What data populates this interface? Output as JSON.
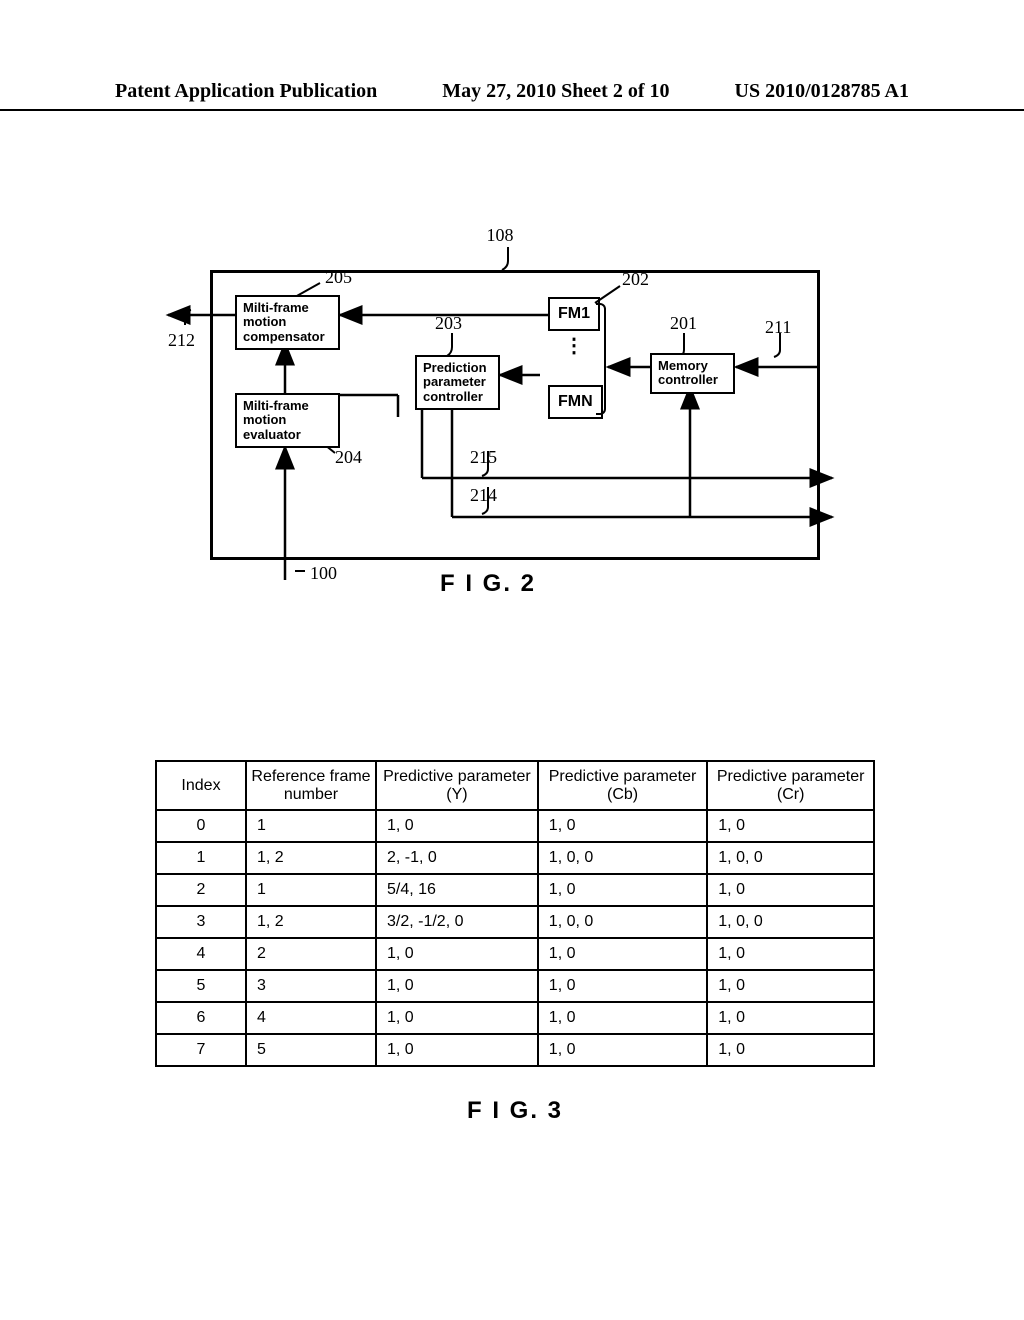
{
  "header": {
    "left": "Patent Application Publication",
    "middle": "May 27, 2010  Sheet 2 of 10",
    "right": "US 2010/0128785 A1"
  },
  "fig2": {
    "top_ref": "108",
    "ref_205": "205",
    "ref_202": "202",
    "ref_212": "212",
    "ref_203": "203",
    "ref_201": "201",
    "ref_211": "211",
    "ref_204": "204",
    "ref_215": "215",
    "ref_214": "214",
    "ref_100": "100",
    "blocks": {
      "compensator": "Milti-frame\nmotion\ncompensator",
      "param_ctrl": "Prediction\nparameter\ncontroller",
      "fm1": "FM1",
      "fmn": "FMN",
      "mem_ctrl": "Memory\ncontroller",
      "evaluator": "Milti-frame\nmotion\nevaluator"
    },
    "label": "F I G. 2"
  },
  "fig3": {
    "headers": {
      "index": "Index",
      "ref": "Reference frame number",
      "y": "Predictive parameter (Y)",
      "cb": "Predictive parameter (Cb)",
      "cr": "Predictive parameter (Cr)"
    },
    "rows": [
      {
        "index": "0",
        "ref": "1",
        "y": "1, 0",
        "cb": "1, 0",
        "cr": "1, 0"
      },
      {
        "index": "1",
        "ref": "1, 2",
        "y": "2, -1, 0",
        "cb": "1, 0, 0",
        "cr": "1, 0, 0"
      },
      {
        "index": "2",
        "ref": "1",
        "y": "5/4, 16",
        "cb": "1, 0",
        "cr": "1, 0"
      },
      {
        "index": "3",
        "ref": "1, 2",
        "y": "3/2, -1/2, 0",
        "cb": "1, 0, 0",
        "cr": "1, 0, 0"
      },
      {
        "index": "4",
        "ref": "2",
        "y": "1, 0",
        "cb": "1, 0",
        "cr": "1, 0"
      },
      {
        "index": "5",
        "ref": "3",
        "y": "1, 0",
        "cb": "1, 0",
        "cr": "1, 0"
      },
      {
        "index": "6",
        "ref": "4",
        "y": "1, 0",
        "cb": "1, 0",
        "cr": "1, 0"
      },
      {
        "index": "7",
        "ref": "5",
        "y": "1, 0",
        "cb": "1, 0",
        "cr": "1, 0"
      }
    ],
    "label": "F I G. 3"
  },
  "chart_data": {
    "type": "table",
    "title": "F I G. 3",
    "columns": [
      "Index",
      "Reference frame number",
      "Predictive parameter (Y)",
      "Predictive parameter (Cb)",
      "Predictive parameter (Cr)"
    ],
    "rows": [
      [
        "0",
        "1",
        "1, 0",
        "1, 0",
        "1, 0"
      ],
      [
        "1",
        "1, 2",
        "2, -1, 0",
        "1, 0, 0",
        "1, 0, 0"
      ],
      [
        "2",
        "1",
        "5/4, 16",
        "1, 0",
        "1, 0"
      ],
      [
        "3",
        "1, 2",
        "3/2, -1/2, 0",
        "1, 0, 0",
        "1, 0, 0"
      ],
      [
        "4",
        "2",
        "1, 0",
        "1, 0",
        "1, 0"
      ],
      [
        "5",
        "3",
        "1, 0",
        "1, 0",
        "1, 0"
      ],
      [
        "6",
        "4",
        "1, 0",
        "1, 0",
        "1, 0"
      ],
      [
        "7",
        "5",
        "1, 0",
        "1, 0",
        "1, 0"
      ]
    ]
  }
}
